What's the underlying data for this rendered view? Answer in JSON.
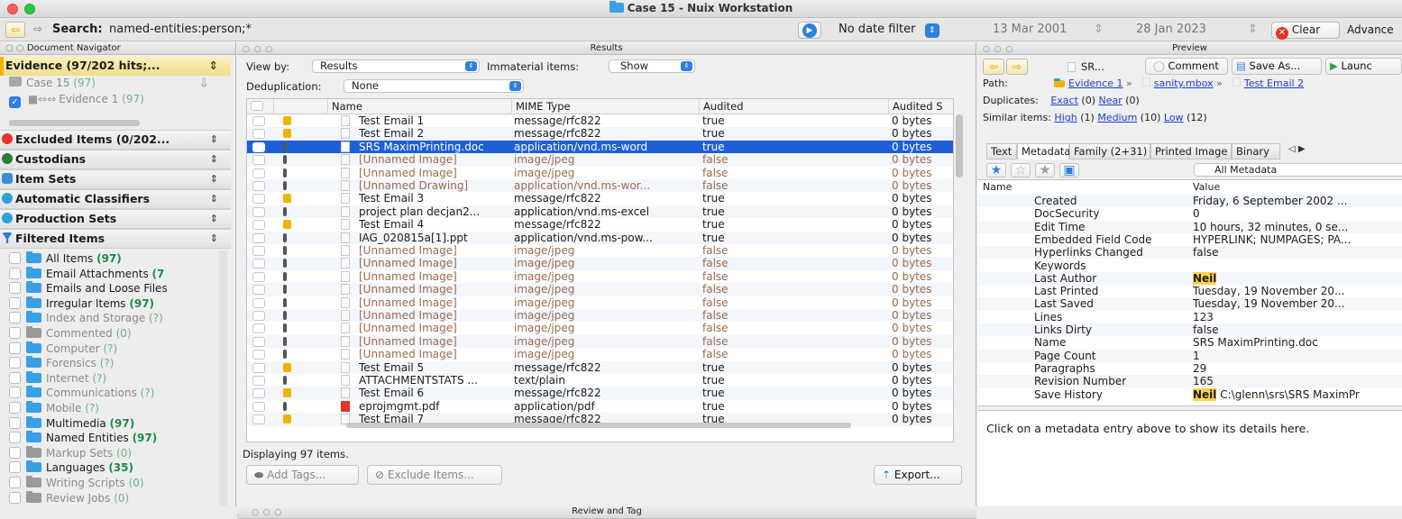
{
  "window": {
    "title": "Case 15 - Nuix Workstation"
  },
  "toolbar": {
    "search_label": "Search:",
    "search_query": "named-entities:person;*",
    "date_filter": "No date filter",
    "date_from": "13 Mar 2001",
    "date_to": "28 Jan 2023",
    "clear_label": "Clear",
    "advanced_label": "Advance"
  },
  "navigator": {
    "title": "Document Navigator",
    "evidence_header": "Evidence (97/202 hits;...",
    "case_label": "Case 15",
    "case_count": "(97)",
    "evidence_label": "Evidence 1",
    "evidence_count": "(97)",
    "sections": [
      "Excluded Items (0/202...",
      "Custodians",
      "Item Sets",
      "Automatic Classifiers",
      "Production Sets",
      "Filtered Items"
    ],
    "filters": [
      {
        "label": "All Items",
        "count": "(97)",
        "dim": false,
        "gray": false
      },
      {
        "label": "Email Attachments",
        "count": "(7",
        "dim": false,
        "gray": false
      },
      {
        "label": "Emails and Loose Files",
        "count": "",
        "dim": false,
        "gray": false
      },
      {
        "label": "Irregular Items",
        "count": "(97)",
        "dim": false,
        "gray": false
      },
      {
        "label": "Index and Storage",
        "count": "(?)",
        "dim": true,
        "gray": false
      },
      {
        "label": "Commented",
        "count": "(0)",
        "dim": true,
        "gray": true
      },
      {
        "label": "Computer",
        "count": "(?)",
        "dim": true,
        "gray": false
      },
      {
        "label": "Forensics",
        "count": "(?)",
        "dim": true,
        "gray": false
      },
      {
        "label": "Internet",
        "count": "(?)",
        "dim": true,
        "gray": false
      },
      {
        "label": "Communications",
        "count": "(?)",
        "dim": true,
        "gray": false
      },
      {
        "label": "Mobile",
        "count": "(?)",
        "dim": true,
        "gray": false
      },
      {
        "label": "Multimedia",
        "count": "(97)",
        "dim": false,
        "gray": false
      },
      {
        "label": "Named Entities",
        "count": "(97)",
        "dim": false,
        "gray": false
      },
      {
        "label": "Markup Sets",
        "count": "(0)",
        "dim": true,
        "gray": true
      },
      {
        "label": "Languages",
        "count": "(35)",
        "dim": false,
        "gray": false
      },
      {
        "label": "Writing Scripts",
        "count": "(0)",
        "dim": true,
        "gray": true
      },
      {
        "label": "Review Jobs",
        "count": "(0)",
        "dim": true,
        "gray": true
      }
    ]
  },
  "results": {
    "title": "Results",
    "view_by_label": "View by:",
    "view_by_value": "Results",
    "immaterial_label": "Immaterial items:",
    "immaterial_value": "Show",
    "dedup_label": "Deduplication:",
    "dedup_value": "None",
    "columns": [
      "Name",
      "MIME Type",
      "Audited",
      "Audited S"
    ],
    "rows": [
      {
        "name": "Test Email 1",
        "mime": "message/rfc822",
        "audited": "true",
        "size": "0 bytes",
        "type": "email"
      },
      {
        "name": "Test Email 2",
        "mime": "message/rfc822",
        "audited": "true",
        "size": "0 bytes",
        "type": "email"
      },
      {
        "name": "SRS MaximPrinting.doc",
        "mime": "application/vnd.ms-word",
        "audited": "true",
        "size": "0 bytes",
        "type": "doc",
        "selected": true
      },
      {
        "name": "[Unnamed Image]",
        "mime": "image/jpeg",
        "audited": "false",
        "size": "0 bytes",
        "type": "att",
        "gray": true
      },
      {
        "name": "[Unnamed Image]",
        "mime": "image/jpeg",
        "audited": "false",
        "size": "0 bytes",
        "type": "att",
        "gray": true
      },
      {
        "name": "[Unnamed Drawing]",
        "mime": "application/vnd.ms-wor...",
        "audited": "false",
        "size": "0 bytes",
        "type": "att",
        "gray": true
      },
      {
        "name": "Test Email 3",
        "mime": "message/rfc822",
        "audited": "true",
        "size": "0 bytes",
        "type": "email"
      },
      {
        "name": "project plan decjan2...",
        "mime": "application/vnd.ms-excel",
        "audited": "true",
        "size": "0 bytes",
        "type": "att"
      },
      {
        "name": "Test Email 4",
        "mime": "message/rfc822",
        "audited": "true",
        "size": "0 bytes",
        "type": "email"
      },
      {
        "name": "IAG_020815a[1].ppt",
        "mime": "application/vnd.ms-pow...",
        "audited": "true",
        "size": "0 bytes",
        "type": "att"
      },
      {
        "name": "[Unnamed Image]",
        "mime": "image/jpeg",
        "audited": "false",
        "size": "0 bytes",
        "type": "att",
        "gray": true
      },
      {
        "name": "[Unnamed Image]",
        "mime": "image/jpeg",
        "audited": "false",
        "size": "0 bytes",
        "type": "att",
        "gray": true
      },
      {
        "name": "[Unnamed Image]",
        "mime": "image/jpeg",
        "audited": "false",
        "size": "0 bytes",
        "type": "att",
        "gray": true
      },
      {
        "name": "[Unnamed Image]",
        "mime": "image/jpeg",
        "audited": "false",
        "size": "0 bytes",
        "type": "att",
        "gray": true
      },
      {
        "name": "[Unnamed Image]",
        "mime": "image/jpeg",
        "audited": "false",
        "size": "0 bytes",
        "type": "att",
        "gray": true
      },
      {
        "name": "[Unnamed Image]",
        "mime": "image/jpeg",
        "audited": "false",
        "size": "0 bytes",
        "type": "att",
        "gray": true
      },
      {
        "name": "[Unnamed Image]",
        "mime": "image/jpeg",
        "audited": "false",
        "size": "0 bytes",
        "type": "att",
        "gray": true
      },
      {
        "name": "[Unnamed Image]",
        "mime": "image/jpeg",
        "audited": "false",
        "size": "0 bytes",
        "type": "att",
        "gray": true
      },
      {
        "name": "[Unnamed Image]",
        "mime": "image/jpeg",
        "audited": "false",
        "size": "0 bytes",
        "type": "att",
        "gray": true
      },
      {
        "name": "Test Email 5",
        "mime": "message/rfc822",
        "audited": "true",
        "size": "0 bytes",
        "type": "email"
      },
      {
        "name": "ATTACHMENTSTATS ...",
        "mime": "text/plain",
        "audited": "true",
        "size": "0 bytes",
        "type": "att"
      },
      {
        "name": "Test Email 6",
        "mime": "message/rfc822",
        "audited": "true",
        "size": "0 bytes",
        "type": "email"
      },
      {
        "name": "eprojmgmt.pdf",
        "mime": "application/pdf",
        "audited": "true",
        "size": "0 bytes",
        "type": "att",
        "pdf": true
      },
      {
        "name": "Test Email 7",
        "mime": "message/rfc822",
        "audited": "true",
        "size": "0 bytes",
        "type": "email"
      }
    ],
    "status": "Displaying 97 items.",
    "add_tags_label": "Add Tags...",
    "exclude_label": "Exclude Items...",
    "export_label": "Export..."
  },
  "review_tag": {
    "title": "Review and Tag"
  },
  "preview": {
    "title": "Preview",
    "doc_label": "SR...",
    "comment_label": "Comment",
    "save_as_label": "Save As...",
    "launch_label": "Launc",
    "path_label": "Path:",
    "path": [
      "Evidence 1",
      "sanity.mbox",
      "Test Email 2"
    ],
    "duplicates_label": "Duplicates:",
    "dup_exact": "Exact",
    "dup_exact_count": "(0)",
    "dup_near": "Near",
    "dup_near_count": "(0)",
    "similar_label": "Similar items:",
    "sim_high": "High",
    "sim_high_count": "(1)",
    "sim_medium": "Medium",
    "sim_medium_count": "(10)",
    "sim_low": "Low",
    "sim_low_count": "(12)",
    "tabs": [
      "Text",
      "Metadata",
      "Family (2+31)",
      "Printed Image",
      "Binary"
    ],
    "active_tab": "Metadata",
    "metadata_filter": "All Metadata",
    "meta_columns": [
      "Name",
      "Value"
    ],
    "metadata": [
      {
        "name": "Created",
        "value": "Friday, 6 September 2002 ..."
      },
      {
        "name": "DocSecurity",
        "value": "0"
      },
      {
        "name": "Edit Time",
        "value": "10 hours, 32 minutes, 0 se..."
      },
      {
        "name": "Embedded Field Code",
        "value": "HYPERLINK; NUMPAGES; PA..."
      },
      {
        "name": "Hyperlinks Changed",
        "value": "false"
      },
      {
        "name": "Keywords",
        "value": ""
      },
      {
        "name": "Last Author",
        "value": "Neil",
        "highlight": true
      },
      {
        "name": "Last Printed",
        "value": "Tuesday, 19 November 20..."
      },
      {
        "name": "Last Saved",
        "value": "Tuesday, 19 November 20..."
      },
      {
        "name": "Lines",
        "value": "123"
      },
      {
        "name": "Links Dirty",
        "value": "false"
      },
      {
        "name": "Name",
        "value": "SRS MaximPrinting.doc"
      },
      {
        "name": "Page Count",
        "value": "1"
      },
      {
        "name": "Paragraphs",
        "value": "29"
      },
      {
        "name": "Revision Number",
        "value": "165"
      },
      {
        "name": "Save History",
        "value": "Neil",
        "value_rest": " C:\\glenn\\srs\\SRS MaximPr",
        "highlight": true
      }
    ],
    "details_hint": "Click on a metadata entry above to show its details here."
  },
  "colors": {
    "accent": "#1f5fd6",
    "email_icon": "#f2b300",
    "attach_icon": "#555555",
    "count_green": "#1a8a4a",
    "highlight": "#ffd24a"
  }
}
